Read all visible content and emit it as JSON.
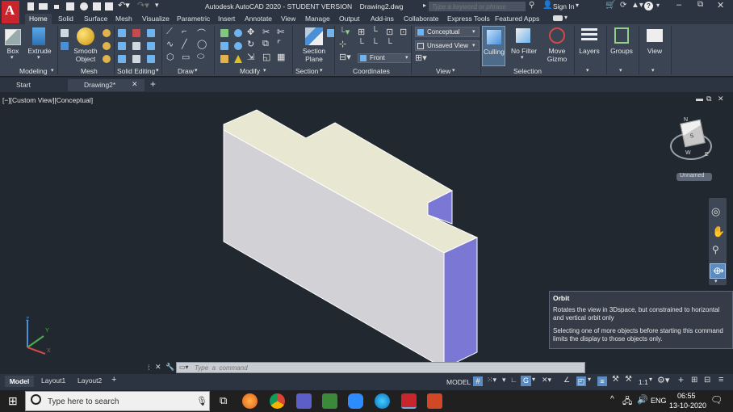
{
  "app": {
    "title": "Autodesk AutoCAD 2020 - STUDENT VERSION",
    "filename": "Drawing2.dwg",
    "search_placeholder": "Type a keyword or phrase",
    "sign_in": "Sign In",
    "logo_letter": "A"
  },
  "ribbon_tabs": [
    "Home",
    "Solid",
    "Surface",
    "Mesh",
    "Visualize",
    "Parametric",
    "Insert",
    "Annotate",
    "View",
    "Manage",
    "Output",
    "Add-ins",
    "Collaborate",
    "Express Tools",
    "Featured Apps"
  ],
  "ribbon": {
    "box": "Box",
    "extrude": "Extrude",
    "smooth_object": [
      "Smooth",
      "Object"
    ],
    "section_plane": [
      "Section",
      "Plane"
    ],
    "visual_style": "Conceptual",
    "view_name": "Unsaved View",
    "ucs_view": "Front",
    "culling": "Culling",
    "no_filter": "No Filter",
    "move_gizmo": [
      "Move",
      "Gizmo"
    ],
    "layers": "Layers",
    "groups": "Groups",
    "view": "View",
    "panels": [
      "Modeling",
      "Mesh",
      "Solid Editing",
      "Draw",
      "Modify",
      "Section",
      "Coordinates",
      "View",
      "Selection"
    ]
  },
  "doc_tabs": {
    "start": "Start",
    "drawing": "Drawing2*"
  },
  "viewport": {
    "label": "[−][Custom View][Conceptual]",
    "viewcube_label": "Unnamed",
    "viewcube_face": "S",
    "compass": {
      "n": "N",
      "e": "E",
      "s": "S",
      "w": "W"
    },
    "ucs": {
      "x": "X",
      "y": "Y",
      "z": "Z"
    },
    "colors": {
      "top": "#e8e8d2",
      "front": "#d2d2d6",
      "side": "#7a78d4",
      "edge": "#ffffff"
    }
  },
  "tooltip": {
    "title": "Orbit",
    "line1": "Rotates the view in 3Dspace, but constrained to horizontal and vertical orbit only",
    "line2": "Selecting one of more objects before starting this command limits the display to those objects only."
  },
  "command": {
    "placeholder": "Type  a  command"
  },
  "layout_tabs": [
    "Model",
    "Layout1",
    "Layout2"
  ],
  "status": {
    "model": "MODEL",
    "scale": "1:1"
  },
  "taskbar": {
    "search": "Type here to search",
    "lang": "ENG",
    "time": "06:55",
    "date": "13-10-2020"
  }
}
